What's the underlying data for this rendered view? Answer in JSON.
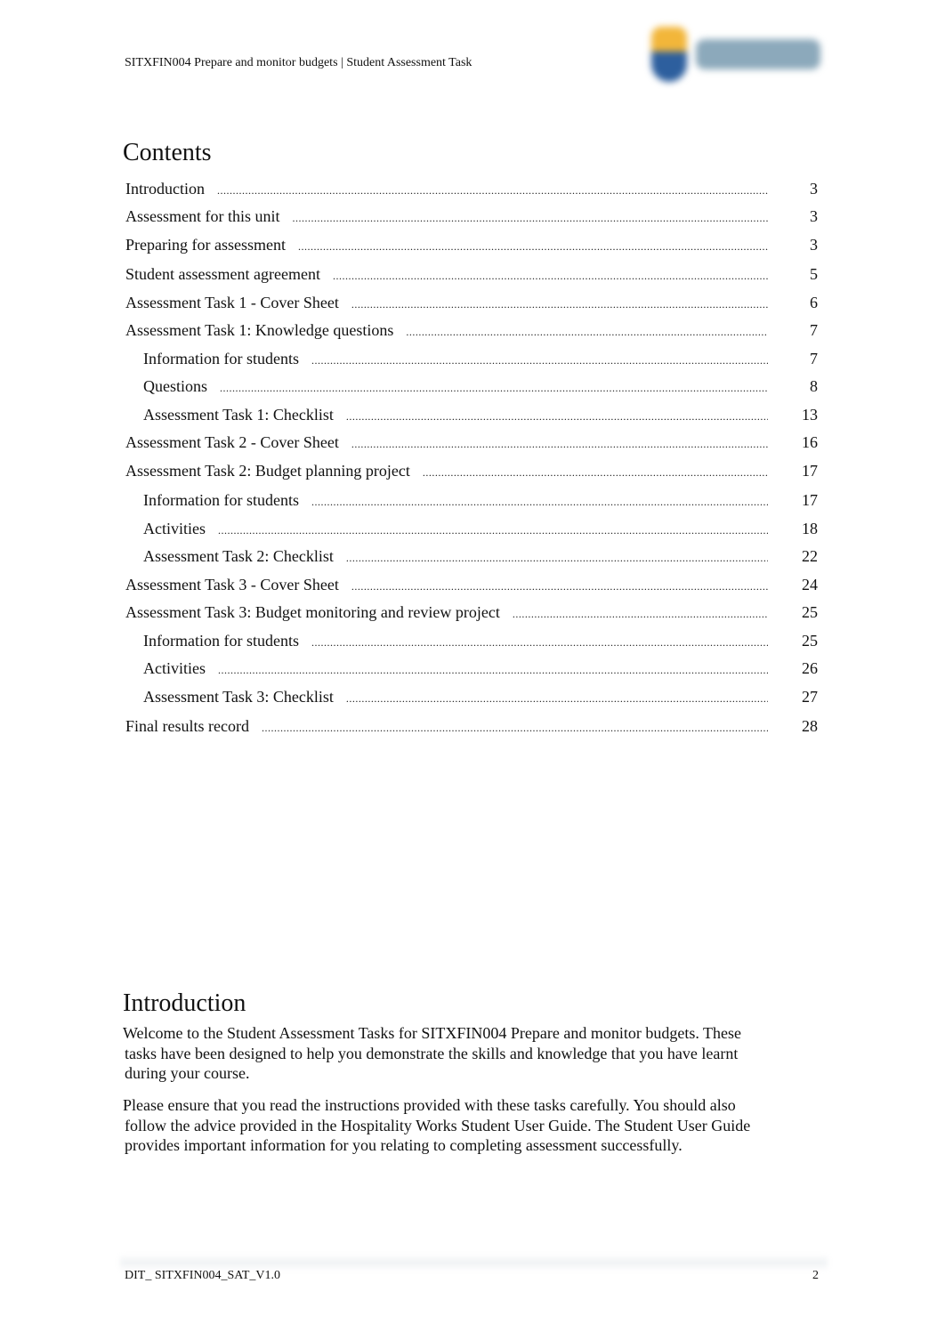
{
  "header": {
    "title": "SITXFIN004 Prepare and monitor budgets | Student Assessment Task",
    "logo_text": "Darwin"
  },
  "contents": {
    "heading": "Contents",
    "entries": [
      {
        "label": "Introduction",
        "page": "3",
        "level": 1
      },
      {
        "label": "Assessment for this unit",
        "page": "3",
        "level": 1
      },
      {
        "label": "Preparing for assessment",
        "page": "3",
        "level": 1
      },
      {
        "label": "Student assessment agreement",
        "page": "5",
        "level": 1
      },
      {
        "label": "Assessment Task 1 - Cover Sheet",
        "page": "6",
        "level": 1
      },
      {
        "label": "Assessment Task 1: Knowledge questions",
        "page": "7",
        "level": 1
      },
      {
        "label": "Information for students",
        "page": "7",
        "level": 2
      },
      {
        "label": "Questions",
        "page": "8",
        "level": 2
      },
      {
        "label": "Assessment Task 1: Checklist",
        "page": "13",
        "level": 2
      },
      {
        "label": "Assessment Task 2 - Cover Sheet",
        "page": "16",
        "level": 1
      },
      {
        "label": "Assessment Task 2: Budget planning project",
        "page": "17",
        "level": 1
      },
      {
        "label": "Information for students",
        "page": "17",
        "level": 2
      },
      {
        "label": "Activities",
        "page": "18",
        "level": 2
      },
      {
        "label": "Assessment Task 2: Checklist",
        "page": "22",
        "level": 2
      },
      {
        "label": "Assessment Task 3 - Cover Sheet",
        "page": "24",
        "level": 1
      },
      {
        "label": "Assessment Task 3: Budget monitoring and review project",
        "page": "25",
        "level": 1
      },
      {
        "label": "Information for students",
        "page": "25",
        "level": 2
      },
      {
        "label": "Activities",
        "page": "26",
        "level": 2
      },
      {
        "label": "Assessment Task 3: Checklist",
        "page": "27",
        "level": 2
      },
      {
        "label": "Final results record",
        "page": "28",
        "level": 1
      }
    ]
  },
  "introduction": {
    "heading": "Introduction",
    "p1_lines": [
      "Welcome to the Student Assessment Tasks for SITXFIN004 Prepare and monitor budgets. These",
      "tasks have been designed to help you demonstrate the skills and knowledge that you have learnt",
      "during your course."
    ],
    "p2_lines": [
      "Please ensure that you read the instructions provided with these tasks carefully. You should also",
      "follow the advice provided in the Hospitality Works Student User Guide. The Student User Guide",
      "provides important information for you relating to completing assessment successfully."
    ]
  },
  "footer": {
    "doc_id": "DIT_ SITXFIN004_SAT_V1.0",
    "page": "2"
  }
}
